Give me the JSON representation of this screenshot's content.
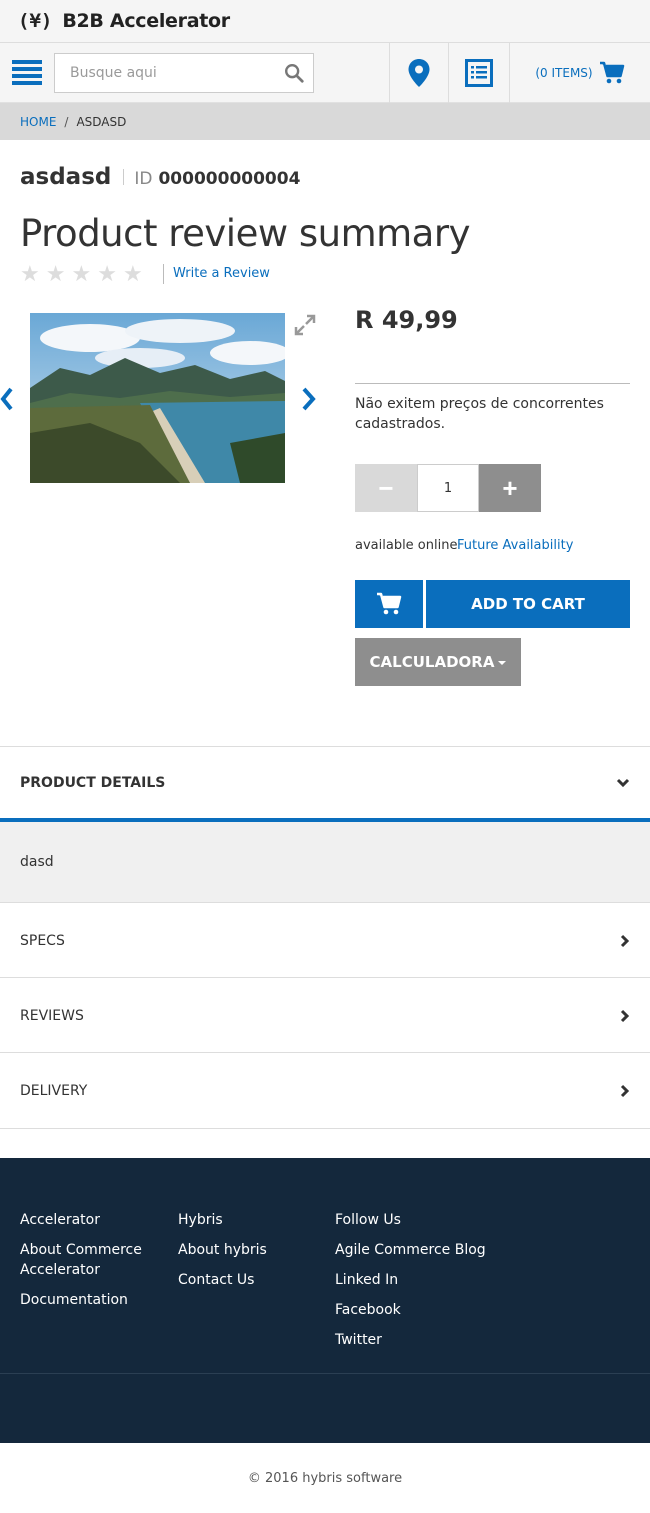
{
  "brand": {
    "mark": "(¥)",
    "name": "B2B Accelerator"
  },
  "header": {
    "search_placeholder": "Busque aqui",
    "cart_label": "(0 ITEMS)"
  },
  "breadcrumb": {
    "home": "HOME",
    "separator": "/",
    "current": "ASDASD"
  },
  "product": {
    "name": "asdasd",
    "id_label": "ID",
    "id": "000000000004",
    "review_title": "Product review summary",
    "rating": 0,
    "rating_max": 5,
    "write_review": "Write a Review",
    "price": "R 49,99",
    "competitor_text": "Não exitem preços de concorrentes cadastrados.",
    "quantity": "1",
    "minus_label": "−",
    "plus_label": "+",
    "availability": "available online",
    "future_availability": "Future Availability",
    "add_to_cart": "ADD TO CART",
    "calculator": "CALCULADORA"
  },
  "accordion": {
    "details_label": "PRODUCT DETAILS",
    "details_body": "dasd",
    "specs_label": "SPECS",
    "reviews_label": "REVIEWS",
    "delivery_label": "DELIVERY"
  },
  "footer": {
    "col1": [
      "Accelerator",
      "About Commerce Accelerator",
      "Documentation"
    ],
    "col2": [
      "Hybris",
      "About hybris",
      "Contact Us"
    ],
    "col3": [
      "Follow Us",
      "Agile Commerce Blog",
      "Linked In",
      "Facebook",
      "Twitter"
    ],
    "copyright": "© 2016 hybris software"
  },
  "colors": {
    "accent": "#0a6ebd",
    "footer_bg": "#14283c",
    "breadcrumb_bg": "#d9d9d9",
    "gray_button": "#8e8e8e"
  },
  "icons": [
    "menu-icon",
    "search-icon",
    "location-pin-icon",
    "list-icon",
    "cart-icon",
    "chevron-left-icon",
    "chevron-right-icon",
    "expand-icon",
    "chevron-down-icon"
  ]
}
